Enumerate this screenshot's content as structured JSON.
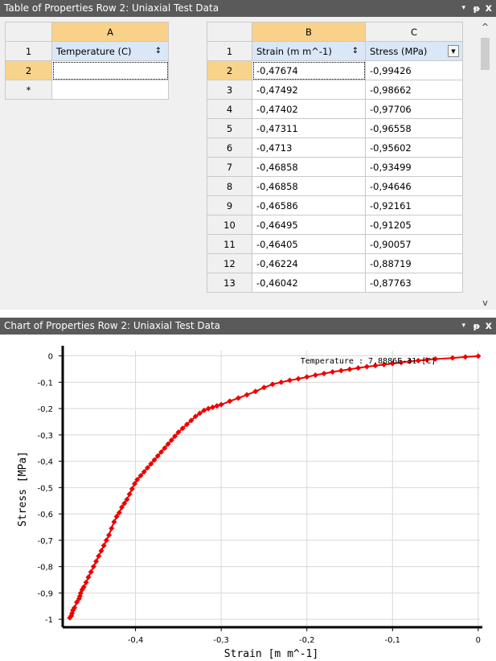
{
  "table_panel": {
    "title": "Table of Properties Row 2: Uniaxial Test Data",
    "dropdown_glyph": "▾",
    "pin_glyph": "ᵽ",
    "close_glyph": "x"
  },
  "left_table": {
    "column_letter": "A",
    "header_row_num": "1",
    "header": "Temperature (C)",
    "rows": [
      {
        "num": "2",
        "value": ""
      },
      {
        "num": "*",
        "value": ""
      }
    ]
  },
  "right_table": {
    "column_letters": [
      "B",
      "C"
    ],
    "header_row_num": "1",
    "headers": [
      "Strain (m m^-1)",
      "Stress (MPa)"
    ],
    "rows": [
      {
        "num": "2",
        "strain": "-0,47674",
        "stress": "-0,99426"
      },
      {
        "num": "3",
        "strain": "-0,47492",
        "stress": "-0,98662"
      },
      {
        "num": "4",
        "strain": "-0,47402",
        "stress": "-0,97706"
      },
      {
        "num": "5",
        "strain": "-0,47311",
        "stress": "-0,96558"
      },
      {
        "num": "6",
        "strain": "-0,4713",
        "stress": "-0,95602"
      },
      {
        "num": "7",
        "strain": "-0,46858",
        "stress": "-0,93499"
      },
      {
        "num": "8",
        "strain": "-0,46858",
        "stress": "-0,94646"
      },
      {
        "num": "9",
        "strain": "-0,46586",
        "stress": "-0,92161"
      },
      {
        "num": "10",
        "strain": "-0,46495",
        "stress": "-0,91205"
      },
      {
        "num": "11",
        "strain": "-0,46405",
        "stress": "-0,90057"
      },
      {
        "num": "12",
        "strain": "-0,46224",
        "stress": "-0,88719"
      },
      {
        "num": "13",
        "strain": "-0,46042",
        "stress": "-0,87763"
      }
    ]
  },
  "chart_panel": {
    "title": "Chart of Properties Row 2: Uniaxial Test Data",
    "dropdown_glyph": "▾",
    "pin_glyph": "ᵽ",
    "close_glyph": "x"
  },
  "chart_data": {
    "type": "line",
    "xlabel": "Strain  [m m^-1]",
    "ylabel": "Stress  [MPa]",
    "annotation": "Temperature : 7,8886E-31 [C]",
    "xlim": [
      -0.485,
      0.002
    ],
    "ylim": [
      -1.03,
      0.02
    ],
    "x_ticks": [
      {
        "value": -0.4,
        "label": "-0,4"
      },
      {
        "value": -0.3,
        "label": "-0,3"
      },
      {
        "value": -0.2,
        "label": "-0,2"
      },
      {
        "value": -0.1,
        "label": "-0,1"
      },
      {
        "value": 0,
        "label": "0"
      }
    ],
    "y_ticks": [
      {
        "value": 0,
        "label": "0"
      },
      {
        "value": -0.1,
        "label": "-0,1"
      },
      {
        "value": -0.2,
        "label": "-0,2"
      },
      {
        "value": -0.3,
        "label": "-0,3"
      },
      {
        "value": -0.4,
        "label": "-0,4"
      },
      {
        "value": -0.5,
        "label": "-0,5"
      },
      {
        "value": -0.6,
        "label": "-0,6"
      },
      {
        "value": -0.7,
        "label": "-0,7"
      },
      {
        "value": -0.8,
        "label": "-0,8"
      },
      {
        "value": -0.9,
        "label": "-0,9"
      },
      {
        "value": -1,
        "label": "-1"
      }
    ],
    "grid": true,
    "series": [
      {
        "color": "#ee0000",
        "x": [
          -0.47674,
          -0.47492,
          -0.47402,
          -0.47311,
          -0.4713,
          -0.46858,
          -0.46586,
          -0.46495,
          -0.46405,
          -0.46224,
          -0.46042,
          -0.4577,
          -0.455,
          -0.452,
          -0.449,
          -0.446,
          -0.443,
          -0.44,
          -0.437,
          -0.434,
          -0.431,
          -0.428,
          -0.425,
          -0.422,
          -0.419,
          -0.416,
          -0.413,
          -0.41,
          -0.407,
          -0.404,
          -0.401,
          -0.398,
          -0.394,
          -0.39,
          -0.386,
          -0.382,
          -0.378,
          -0.374,
          -0.37,
          -0.366,
          -0.362,
          -0.358,
          -0.354,
          -0.35,
          -0.345,
          -0.34,
          -0.335,
          -0.33,
          -0.325,
          -0.32,
          -0.315,
          -0.31,
          -0.305,
          -0.3,
          -0.29,
          -0.28,
          -0.27,
          -0.26,
          -0.25,
          -0.24,
          -0.23,
          -0.22,
          -0.21,
          -0.2,
          -0.19,
          -0.18,
          -0.17,
          -0.16,
          -0.15,
          -0.14,
          -0.13,
          -0.12,
          -0.11,
          -0.1,
          -0.09,
          -0.08,
          -0.07,
          -0.06,
          -0.05,
          -0.03,
          -0.015,
          0
        ],
        "y": [
          -0.99426,
          -0.98662,
          -0.97706,
          -0.96558,
          -0.95602,
          -0.93499,
          -0.92161,
          -0.91205,
          -0.90057,
          -0.88719,
          -0.87763,
          -0.86,
          -0.84,
          -0.82,
          -0.8,
          -0.78,
          -0.76,
          -0.74,
          -0.72,
          -0.7,
          -0.68,
          -0.655,
          -0.63,
          -0.61,
          -0.595,
          -0.575,
          -0.56,
          -0.545,
          -0.525,
          -0.505,
          -0.485,
          -0.47,
          -0.455,
          -0.44,
          -0.425,
          -0.41,
          -0.395,
          -0.38,
          -0.365,
          -0.35,
          -0.335,
          -0.32,
          -0.305,
          -0.29,
          -0.275,
          -0.26,
          -0.245,
          -0.23,
          -0.218,
          -0.207,
          -0.2,
          -0.195,
          -0.19,
          -0.185,
          -0.172,
          -0.16,
          -0.148,
          -0.135,
          -0.12,
          -0.108,
          -0.1,
          -0.093,
          -0.087,
          -0.08,
          -0.073,
          -0.067,
          -0.061,
          -0.056,
          -0.051,
          -0.046,
          -0.041,
          -0.037,
          -0.033,
          -0.029,
          -0.025,
          -0.021,
          -0.018,
          -0.015,
          -0.012,
          -0.008,
          -0.004,
          -0.001
        ]
      }
    ]
  }
}
